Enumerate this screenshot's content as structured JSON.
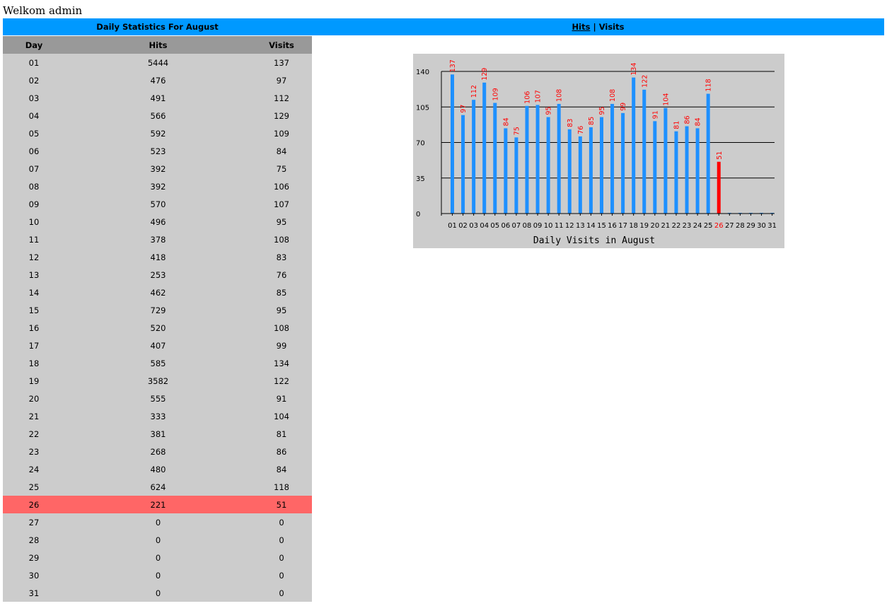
{
  "welcome_text": "Welkom admin",
  "header": {
    "stats_title": "Daily Statistics For August",
    "hits_link": "Hits",
    "separator": "|",
    "visits_label": "Visits"
  },
  "table": {
    "columns": [
      "Day",
      "Hits",
      "Visits"
    ],
    "highlight_day": "26",
    "rows": [
      [
        "01",
        "5444",
        "137"
      ],
      [
        "02",
        "476",
        "97"
      ],
      [
        "03",
        "491",
        "112"
      ],
      [
        "04",
        "566",
        "129"
      ],
      [
        "05",
        "592",
        "109"
      ],
      [
        "06",
        "523",
        "84"
      ],
      [
        "07",
        "392",
        "75"
      ],
      [
        "08",
        "392",
        "106"
      ],
      [
        "09",
        "570",
        "107"
      ],
      [
        "10",
        "496",
        "95"
      ],
      [
        "11",
        "378",
        "108"
      ],
      [
        "12",
        "418",
        "83"
      ],
      [
        "13",
        "253",
        "76"
      ],
      [
        "14",
        "462",
        "85"
      ],
      [
        "15",
        "729",
        "95"
      ],
      [
        "16",
        "520",
        "108"
      ],
      [
        "17",
        "407",
        "99"
      ],
      [
        "18",
        "585",
        "134"
      ],
      [
        "19",
        "3582",
        "122"
      ],
      [
        "20",
        "555",
        "91"
      ],
      [
        "21",
        "333",
        "104"
      ],
      [
        "22",
        "381",
        "81"
      ],
      [
        "23",
        "268",
        "86"
      ],
      [
        "24",
        "480",
        "84"
      ],
      [
        "25",
        "624",
        "118"
      ],
      [
        "26",
        "221",
        "51"
      ],
      [
        "27",
        "0",
        "0"
      ],
      [
        "28",
        "0",
        "0"
      ],
      [
        "29",
        "0",
        "0"
      ],
      [
        "30",
        "0",
        "0"
      ],
      [
        "31",
        "0",
        "0"
      ]
    ]
  },
  "chart_data": {
    "type": "bar",
    "title": "Daily Visits in August",
    "xlabel": "",
    "ylabel": "",
    "categories": [
      "01",
      "02",
      "03",
      "04",
      "05",
      "06",
      "07",
      "08",
      "09",
      "10",
      "11",
      "12",
      "13",
      "14",
      "15",
      "16",
      "17",
      "18",
      "19",
      "20",
      "21",
      "22",
      "23",
      "24",
      "25",
      "26",
      "27",
      "28",
      "29",
      "30",
      "31"
    ],
    "values": [
      137,
      97,
      112,
      129,
      109,
      84,
      75,
      106,
      107,
      95,
      108,
      83,
      76,
      85,
      95,
      108,
      99,
      134,
      122,
      91,
      104,
      81,
      86,
      84,
      118,
      51,
      0,
      0,
      0,
      0,
      0
    ],
    "yticks": [
      0,
      35,
      70,
      105,
      140
    ],
    "ylim": [
      0,
      140
    ],
    "grid": true,
    "highlight_category": "26",
    "colors": {
      "bar": "#1e90ff",
      "highlight_bar": "#ff0000",
      "value_label": "#ff0000",
      "background": "#cccccc"
    }
  }
}
